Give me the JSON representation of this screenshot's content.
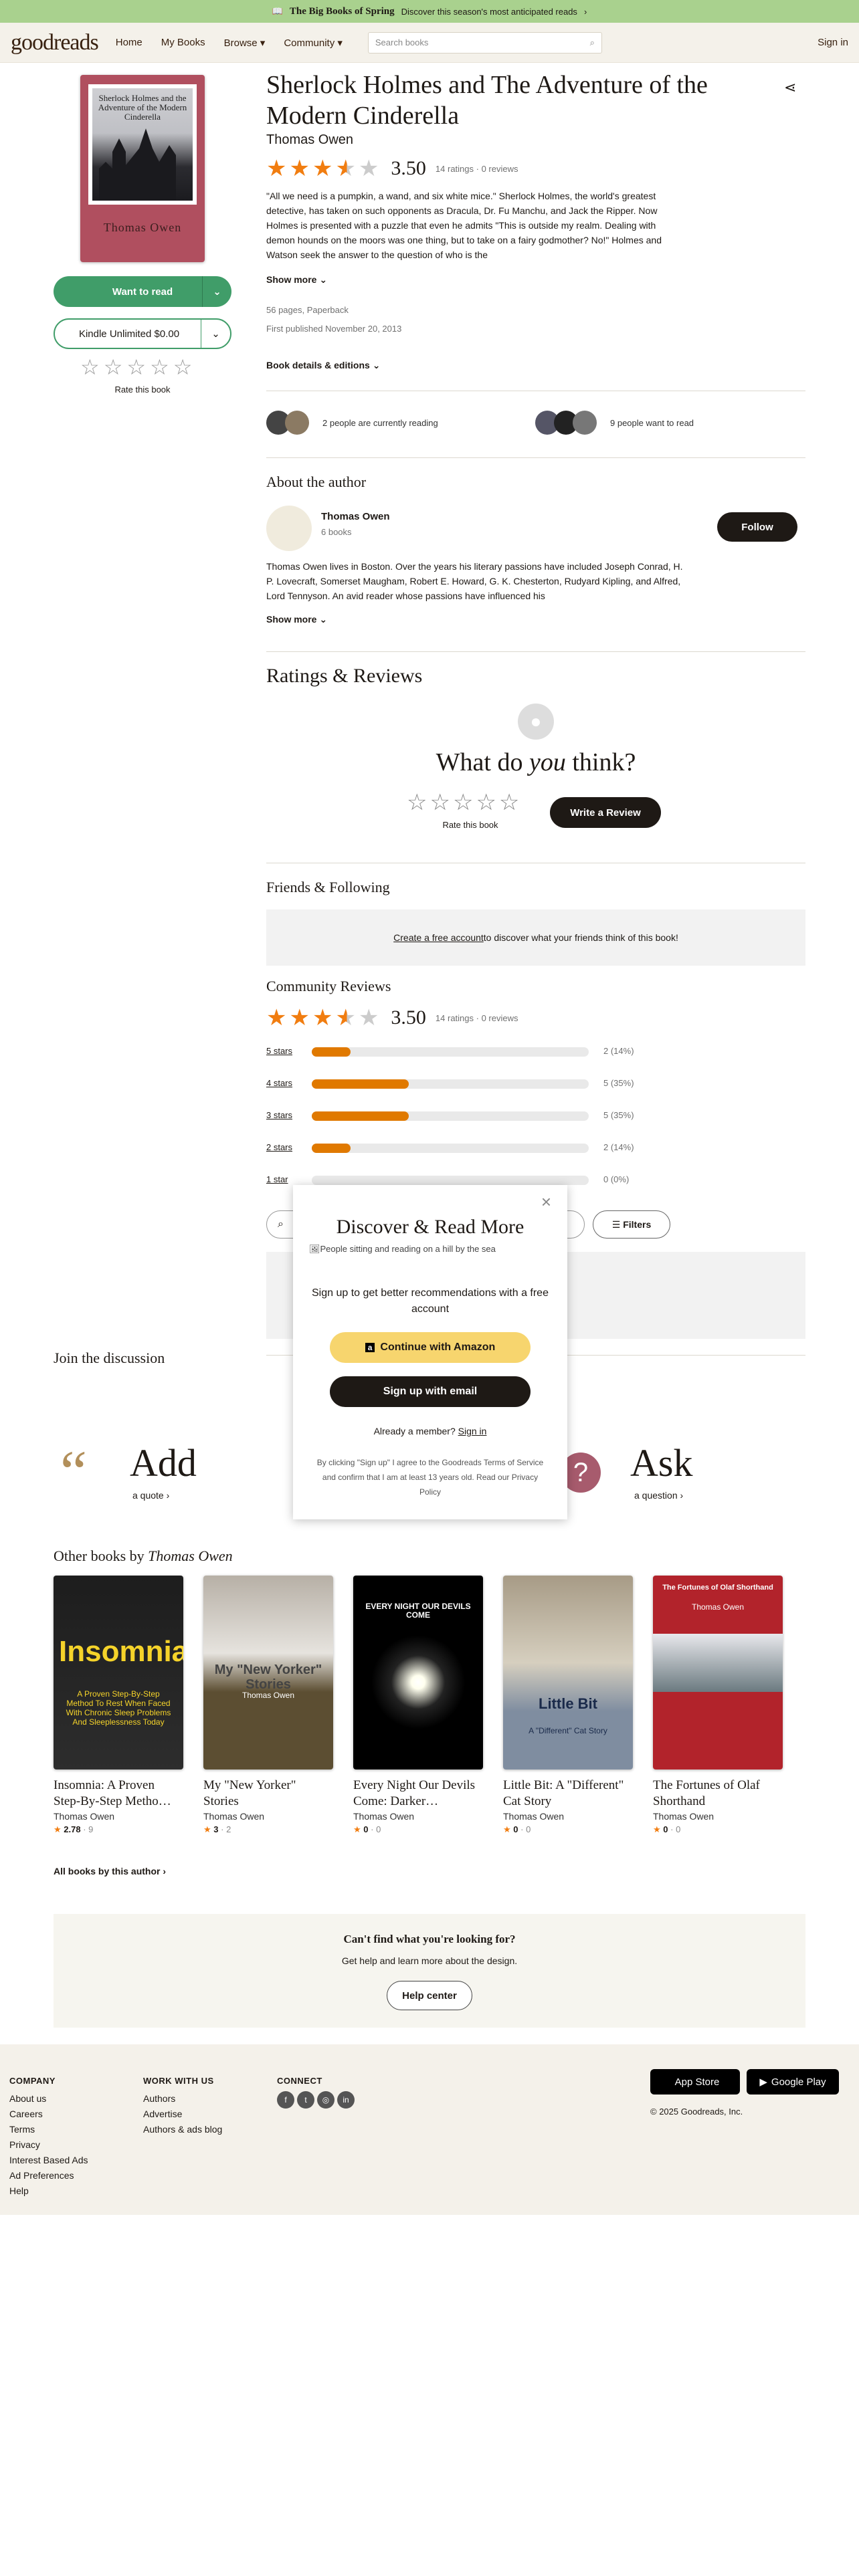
{
  "promo": {
    "title": "The Big Books of Spring",
    "text": "Discover this season's most anticipated reads",
    "arrow": "›"
  },
  "nav": {
    "logo": "goodreads",
    "links": [
      "Home",
      "My Books",
      "Browse ▾",
      "Community ▾"
    ],
    "search_placeholder": "Search books",
    "signin": "Sign in"
  },
  "book": {
    "title": "Sherlock Holmes and The Adventure of the Modern Cinderella",
    "author": "Thomas Owen",
    "cover_title": "Sherlock Holmes and the Adventure of the Modern Cinderella",
    "cover_author": "Thomas Owen",
    "rating": "3.50",
    "ratings_meta": "14 ratings · 0 reviews",
    "description": "\"All we need is a pumpkin, a wand, and six white mice.\" Sherlock Holmes, the world's greatest detective, has taken on such opponents as Dracula, Dr. Fu Manchu, and Jack the Ripper. Now Holmes is presented with a puzzle that even he admits \"This is outside my realm. Dealing with demon hounds on the moors was one thing, but to take on a fairy godmother? No!\" Holmes and Watson seek the answer to the question of who is the",
    "show_more": "Show more",
    "pages": "56 pages, Paperback",
    "published": "First published November 20, 2013",
    "details": "Book details & editions",
    "want_to_read": "Want to read",
    "kindle": "Kindle Unlimited $0.00",
    "rate": "Rate this book"
  },
  "social_stats": {
    "reading": "2 people are currently reading",
    "want": "9 people want to read"
  },
  "author": {
    "heading": "About the author",
    "name": "Thomas Owen",
    "books": "6 books",
    "follow": "Follow",
    "bio": "Thomas Owen lives in Boston. Over the years his literary passions have included Joseph Conrad, H. P. Lovecraft, Somerset Maugham, Robert E. Howard, G. K. Chesterton, Rudyard Kipling, and Alfred, Lord Tennyson. An avid reader whose passions have influenced his",
    "show_more": "Show more"
  },
  "reviews": {
    "heading": "Ratings & Reviews",
    "prompt_a": "What do ",
    "prompt_em": "you",
    "prompt_b": " think?",
    "rate": "Rate this book",
    "write": "Write a Review"
  },
  "friends": {
    "heading": "Friends & Following",
    "link": "Create a free account",
    "text": " to discover what your friends think of this book!"
  },
  "community": {
    "heading": "Community Reviews",
    "rating": "3.50",
    "meta": "14 ratings · 0 reviews",
    "bars": [
      {
        "label": "5 stars",
        "pct": 14,
        "count": "2 (14%)"
      },
      {
        "label": "4 stars",
        "pct": 35,
        "count": "5 (35%)"
      },
      {
        "label": "3 stars",
        "pct": 35,
        "count": "5 (35%)"
      },
      {
        "label": "2 stars",
        "pct": 14,
        "count": "2 (14%)"
      },
      {
        "label": "1 star",
        "pct": 0,
        "count": "0 (0%)"
      }
    ],
    "filters": "Filters"
  },
  "modal": {
    "title": "Discover & Read More",
    "img_alt": "People sitting and reading on a hill by the sea",
    "text": "Sign up to get better recommendations with a free account",
    "amazon": "Continue with Amazon",
    "email": "Sign up with email",
    "member": "Already a member?",
    "signin": "Sign in",
    "legal": "By clicking \"Sign up\" I agree to the Goodreads Terms of Service and confirm that I am at least 13 years old. Read our Privacy Policy"
  },
  "discussion": {
    "heading": "Join the discussion",
    "add": "Add",
    "add_sub": "a quote",
    "ask": "Ask",
    "ask_sub": "a question"
  },
  "other": {
    "heading_a": "Other books by ",
    "heading_b": "Thomas Owen",
    "all": "All books by this author",
    "books": [
      {
        "title": "Insomnia: A Proven Step-By-Step Metho…",
        "author": "Thomas Owen",
        "rating": "2.78",
        "count": "9",
        "cover_title": "Insomnia",
        "cover_sub": "A Proven Step-By-Step Method To Rest When Faced With Chronic Sleep Problems And Sleeplessness Today"
      },
      {
        "title": "My \"New Yorker\" Stories",
        "author": "Thomas Owen",
        "rating": "3",
        "count": "2",
        "cover_title": "My \"New Yorker\" Stories",
        "cover_sub": "Thomas Owen"
      },
      {
        "title": "Every Night Our Devils Come: Darker…",
        "author": "Thomas Owen",
        "rating": "0",
        "count": "0",
        "cover_title": "EVERY NIGHT OUR DEVILS COME",
        "cover_sub": ""
      },
      {
        "title": "Little Bit: A \"Different\" Cat Story",
        "author": "Thomas Owen",
        "rating": "0",
        "count": "0",
        "cover_title": "Little Bit",
        "cover_sub": "A \"Different\" Cat Story"
      },
      {
        "title": "The Fortunes of Olaf Shorthand",
        "author": "Thomas Owen",
        "rating": "0",
        "count": "0",
        "cover_title": "The Fortunes of Olaf Shorthand",
        "cover_sub": "Thomas Owen"
      }
    ]
  },
  "help": {
    "title": "Can't find what you're looking for?",
    "text": "Get help and learn more about the design.",
    "button": "Help center"
  },
  "footer": {
    "company": {
      "title": "COMPANY",
      "links": [
        "About us",
        "Careers",
        "Terms",
        "Privacy",
        "Interest Based Ads",
        "Ad Preferences",
        "Help"
      ]
    },
    "work": {
      "title": "WORK WITH US",
      "links": [
        "Authors",
        "Advertise",
        "Authors & ads blog"
      ]
    },
    "connect": {
      "title": "CONNECT"
    },
    "appstore": "App Store",
    "googleplay": "Google Play",
    "copyright": "© 2025 Goodreads, Inc."
  }
}
